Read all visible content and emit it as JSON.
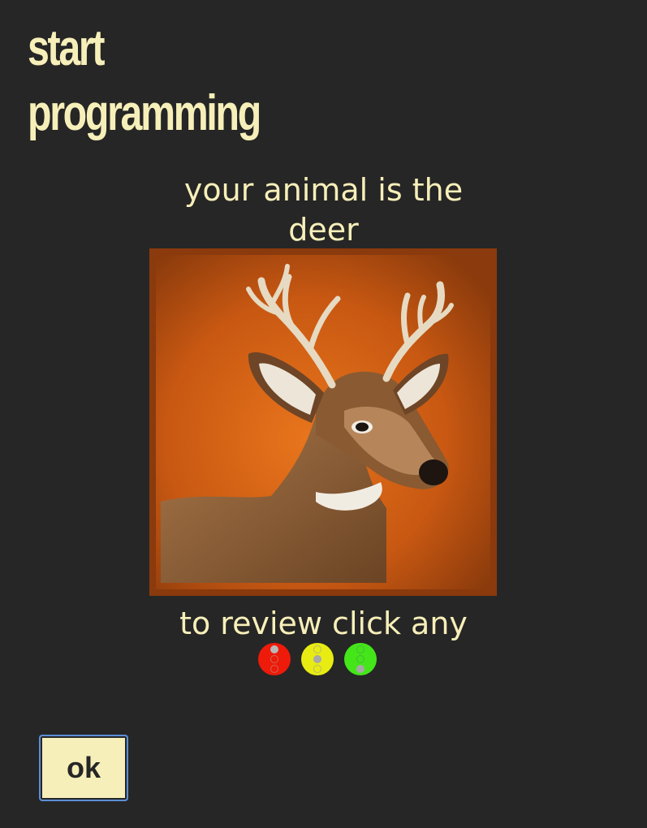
{
  "header": {
    "title_line1": "start",
    "title_line2": "programming"
  },
  "main": {
    "subtitle_line1": "your animal is the",
    "subtitle_line2": "deer",
    "image_alt": "deer",
    "review_text": "to review click any"
  },
  "lights": [
    {
      "name": "red",
      "color": "#ee1a0a",
      "active_dot": "top"
    },
    {
      "name": "yellow",
      "color": "#e8ec12",
      "active_dot": "middle"
    },
    {
      "name": "green",
      "color": "#44e61a",
      "active_dot": "bottom"
    }
  ],
  "buttons": {
    "ok_label": "ok"
  },
  "colors": {
    "background": "#262626",
    "text": "#f7efb9",
    "button_border": "#5b8fd6"
  }
}
